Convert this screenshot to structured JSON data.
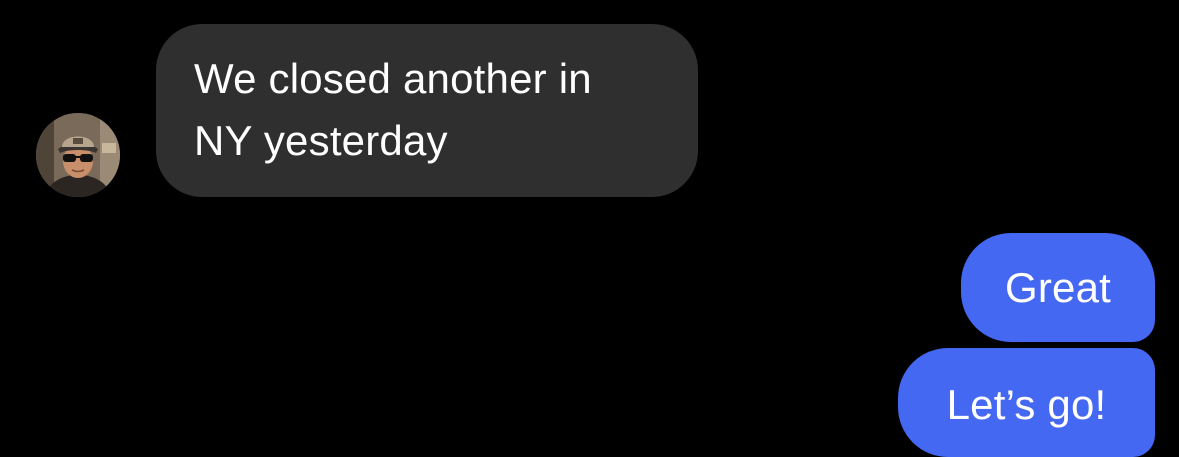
{
  "conversation": {
    "incoming": {
      "avatar_icon": "user-avatar-photo",
      "lines": [
        "We closed another in",
        "NY yesterday"
      ]
    },
    "outgoing": [
      {
        "text": "Great"
      },
      {
        "text": "Let’s go!"
      }
    ]
  },
  "colors": {
    "background": "#000000",
    "incoming_bubble": "#2f2f2f",
    "outgoing_bubble": "#4468f2",
    "text": "#ffffff"
  }
}
